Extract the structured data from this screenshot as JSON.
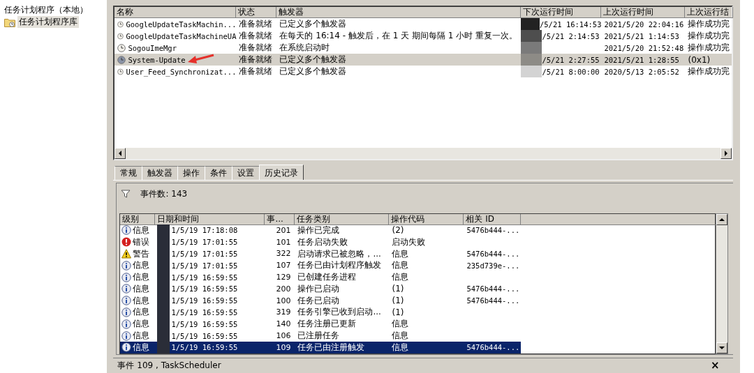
{
  "tree": {
    "root": "任务计划程序（本地）",
    "items": [
      {
        "label": "任务计划程序库",
        "selected": true
      }
    ]
  },
  "task_list": {
    "columns": [
      "名称",
      "状态",
      "触发器",
      "下次运行时间",
      "上次运行时间",
      "上次运行结"
    ],
    "rows": [
      {
        "name": "GoogleUpdateTaskMachin...",
        "status": "准备就绪",
        "trigger": "已定义多个触发器",
        "next_run": "/5/21 16:14:53",
        "last_run": "2021/5/20 22:04:16",
        "last_result": "操作成功完",
        "selected": false,
        "annotated": false
      },
      {
        "name": "GoogleUpdateTaskMachineUA",
        "status": "准备就绪",
        "trigger": "在每天的 16:14 - 触发后，在 1 天 期间每隔 1 小时 重复一次。",
        "next_run": "/5/21 2:14:53",
        "last_run": "2021/5/21 1:14:53",
        "last_result": "操作成功完",
        "selected": false,
        "annotated": false
      },
      {
        "name": "SogouImeMgr",
        "status": "准备就绪",
        "trigger": "在系统启动时",
        "last_run": "2021/5/20 21:52:48",
        "last_result": "操作成功完",
        "selected": false,
        "annotated": false
      },
      {
        "name": "System-Update",
        "status": "准备就绪",
        "trigger": "已定义多个触发器",
        "next_run": "/5/21 2:27:55",
        "last_run": "2021/5/21 1:28:55",
        "last_result": "(0x1)",
        "selected": true,
        "annotated": true
      },
      {
        "name": "User_Feed_Synchronizat...",
        "status": "准备就绪",
        "trigger": "已定义多个触发器",
        "next_run": "/5/21 8:00:00",
        "last_run": "2020/5/13 2:05:52",
        "last_result": "操作成功完",
        "selected": false,
        "annotated": false
      }
    ]
  },
  "details": {
    "tabs": [
      {
        "label": "常规",
        "selected": false
      },
      {
        "label": "触发器",
        "selected": false
      },
      {
        "label": "操作",
        "selected": false
      },
      {
        "label": "条件",
        "selected": false
      },
      {
        "label": "设置",
        "selected": false
      },
      {
        "label": "历史记录",
        "selected": true
      }
    ],
    "event_count": "事件数: 143",
    "events": {
      "columns": [
        "级别",
        "日期和时间",
        "事...",
        "任务类别",
        "操作代码",
        "相关 ID"
      ],
      "rows": [
        {
          "kind": "info",
          "severity": "信息",
          "date": "1/5/19 17:18:08",
          "event_id": "201",
          "category": "操作已完成",
          "op_code": "(2)",
          "correlation_id": "5476b444-...",
          "selected": false
        },
        {
          "kind": "error",
          "severity": "错误",
          "date": "1/5/19 17:01:55",
          "event_id": "101",
          "category": "任务启动失败",
          "op_code": "启动失败",
          "selected": false
        },
        {
          "kind": "warning",
          "severity": "警告",
          "date": "1/5/19 17:01:55",
          "event_id": "322",
          "category": "启动请求已被忽略，...",
          "op_code": "信息",
          "correlation_id": "5476b444-...",
          "selected": false
        },
        {
          "kind": "info",
          "severity": "信息",
          "date": "1/5/19 17:01:55",
          "event_id": "107",
          "category": "任务已由计划程序触发",
          "op_code": "信息",
          "correlation_id": "235d739e-...",
          "selected": false
        },
        {
          "kind": "info",
          "severity": "信息",
          "date": "1/5/19 16:59:55",
          "event_id": "129",
          "category": "已创建任务进程",
          "op_code": "信息",
          "selected": false
        },
        {
          "kind": "info",
          "severity": "信息",
          "date": "1/5/19 16:59:55",
          "event_id": "200",
          "category": "操作已启动",
          "op_code": "(1)",
          "correlation_id": "5476b444-...",
          "selected": false
        },
        {
          "kind": "info",
          "severity": "信息",
          "date": "1/5/19 16:59:55",
          "event_id": "100",
          "category": "任务已启动",
          "op_code": "(1)",
          "correlation_id": "5476b444-...",
          "selected": false
        },
        {
          "kind": "info",
          "severity": "信息",
          "date": "1/5/19 16:59:55",
          "event_id": "319",
          "category": "任务引擎已收到启动...",
          "op_code": "(1)",
          "selected": false
        },
        {
          "kind": "info",
          "severity": "信息",
          "date": "1/5/19 16:59:55",
          "event_id": "140",
          "category": "任务注册已更新",
          "op_code": "信息",
          "selected": false
        },
        {
          "kind": "info",
          "severity": "信息",
          "date": "1/5/19 16:59:55",
          "event_id": "106",
          "category": "已注册任务",
          "op_code": "信息",
          "selected": false
        },
        {
          "kind": "info",
          "severity": "信息",
          "date": "1/5/19 16:59:55",
          "event_id": "109",
          "category": "任务已由注册触发",
          "op_code": "信息",
          "correlation_id": "5476b444-...",
          "selected": true
        }
      ]
    },
    "status": "事件 109 , TaskScheduler",
    "close": "×"
  }
}
